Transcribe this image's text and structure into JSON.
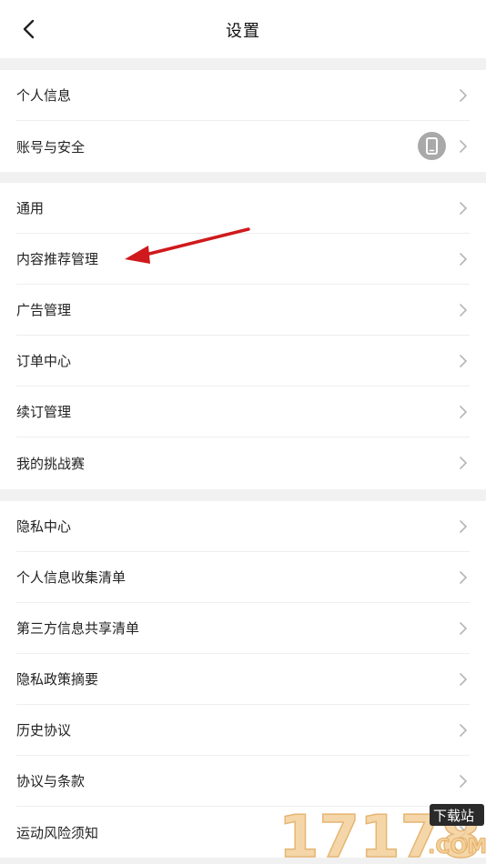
{
  "header": {
    "title": "设置"
  },
  "groups": [
    {
      "items": [
        {
          "label": "个人信息"
        },
        {
          "label": "账号与安全"
        }
      ]
    },
    {
      "items": [
        {
          "label": "通用"
        },
        {
          "label": "内容推荐管理"
        },
        {
          "label": "广告管理"
        },
        {
          "label": "订单中心"
        },
        {
          "label": "续订管理"
        },
        {
          "label": "我的挑战赛"
        }
      ]
    },
    {
      "items": [
        {
          "label": "隐私中心"
        },
        {
          "label": "个人信息收集清单"
        },
        {
          "label": "第三方信息共享清单"
        },
        {
          "label": "隐私政策摘要"
        },
        {
          "label": "历史协议"
        },
        {
          "label": "协议与条款"
        },
        {
          "label": "运动风险须知"
        }
      ]
    }
  ],
  "watermark": {
    "brand": "17178",
    "tag": "下载站",
    "domain": ".COM"
  },
  "colors": {
    "annotation_arrow": "#d0191c",
    "divider": "#f1f1f1",
    "chevron": "#b5b5b5"
  }
}
